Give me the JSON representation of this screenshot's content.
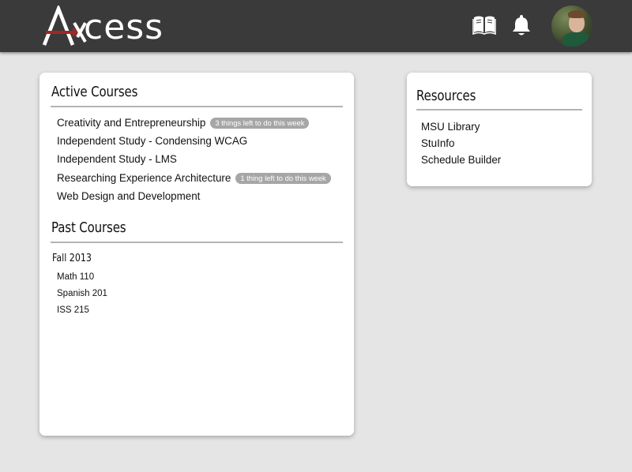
{
  "header": {
    "logo_text": "cess",
    "logo_letter": "A",
    "icons": [
      "book-icon",
      "bell-icon"
    ],
    "avatar": "user-avatar"
  },
  "active_courses": {
    "title": "Active Courses",
    "items": [
      {
        "name": "Creativity and Entrepreneurship",
        "badge": "3 things left to do this week"
      },
      {
        "name": "Independent Study - Condensing WCAG",
        "badge": ""
      },
      {
        "name": "Independent Study - LMS",
        "badge": ""
      },
      {
        "name": "Researching Experience Architecture",
        "badge": "1 thing left to do this week"
      },
      {
        "name": "Web Design and Development",
        "badge": ""
      }
    ]
  },
  "past_courses": {
    "title": "Past Courses",
    "terms": [
      {
        "term": "Fall 2013",
        "courses": [
          "Math 110",
          "Spanish 201",
          "ISS 215"
        ]
      }
    ]
  },
  "resources": {
    "title": "Resources",
    "links": [
      "MSU Library",
      "StuInfo",
      "Schedule Builder"
    ]
  },
  "colors": {
    "topbar": "#3a3a3a",
    "accent_red": "#a32626",
    "background": "#e5e5e5",
    "badge": "#a6a6a6"
  }
}
